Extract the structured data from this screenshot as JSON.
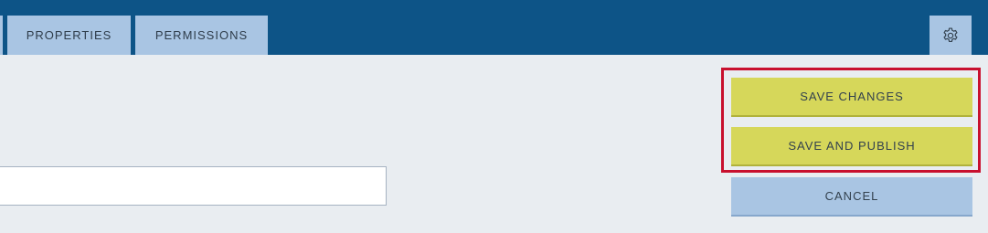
{
  "tabs": {
    "properties_label": "PROPERTIES",
    "permissions_label": "PERMISSIONS"
  },
  "toolbar": {
    "settings_icon": "gear-icon"
  },
  "actions": {
    "save_changes_label": "SAVE CHANGES",
    "save_and_publish_label": "SAVE AND PUBLISH",
    "cancel_label": "CANCEL"
  },
  "form": {
    "text_input_value": ""
  },
  "colors": {
    "header_bg": "#0d5487",
    "tab_bg": "#a9c5e3",
    "primary_button": "#d6d75a",
    "highlight_border": "#c8102e",
    "page_bg": "#e9edf1"
  }
}
